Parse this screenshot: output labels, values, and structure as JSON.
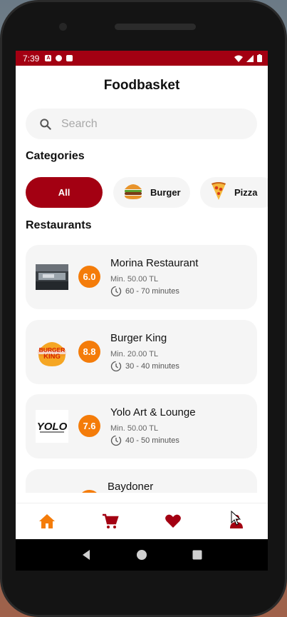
{
  "status_bar": {
    "time": "7:39"
  },
  "header": {
    "title": "Foodbasket"
  },
  "search": {
    "placeholder": "Search"
  },
  "categories": {
    "title": "Categories",
    "items": [
      {
        "label": "All",
        "active": true
      },
      {
        "label": "Burger",
        "icon": "burger-emoji"
      },
      {
        "label": "Pizza",
        "icon": "pizza-emoji"
      }
    ]
  },
  "restaurants": {
    "title": "Restaurants",
    "items": [
      {
        "name": "Morina Restaurant",
        "rating": "6.0",
        "min": "Min. 50.00 TL",
        "time": "60 - 70 minutes",
        "logo": "morina-logo"
      },
      {
        "name": "Burger King",
        "rating": "8.8",
        "min": "Min. 20.00 TL",
        "time": "30 - 40 minutes",
        "logo": "burger-king-logo",
        "logo_text": "BURGER KING"
      },
      {
        "name": "Yolo Art & Lounge",
        "rating": "7.6",
        "min": "Min. 50.00 TL",
        "time": "40 - 50 minutes",
        "logo": "yolo-logo",
        "logo_text": "YOLO"
      },
      {
        "name": "Baydoner",
        "rating": "",
        "min": "",
        "time": "",
        "logo": "baydoner-logo"
      }
    ]
  },
  "bottom_nav": [
    {
      "icon": "home-icon",
      "active": true
    },
    {
      "icon": "cart-icon"
    },
    {
      "icon": "heart-icon"
    },
    {
      "icon": "profile-icon"
    }
  ],
  "colors": {
    "primary": "#a30012",
    "accent": "#f47c0a",
    "surface": "#f5f5f5"
  }
}
